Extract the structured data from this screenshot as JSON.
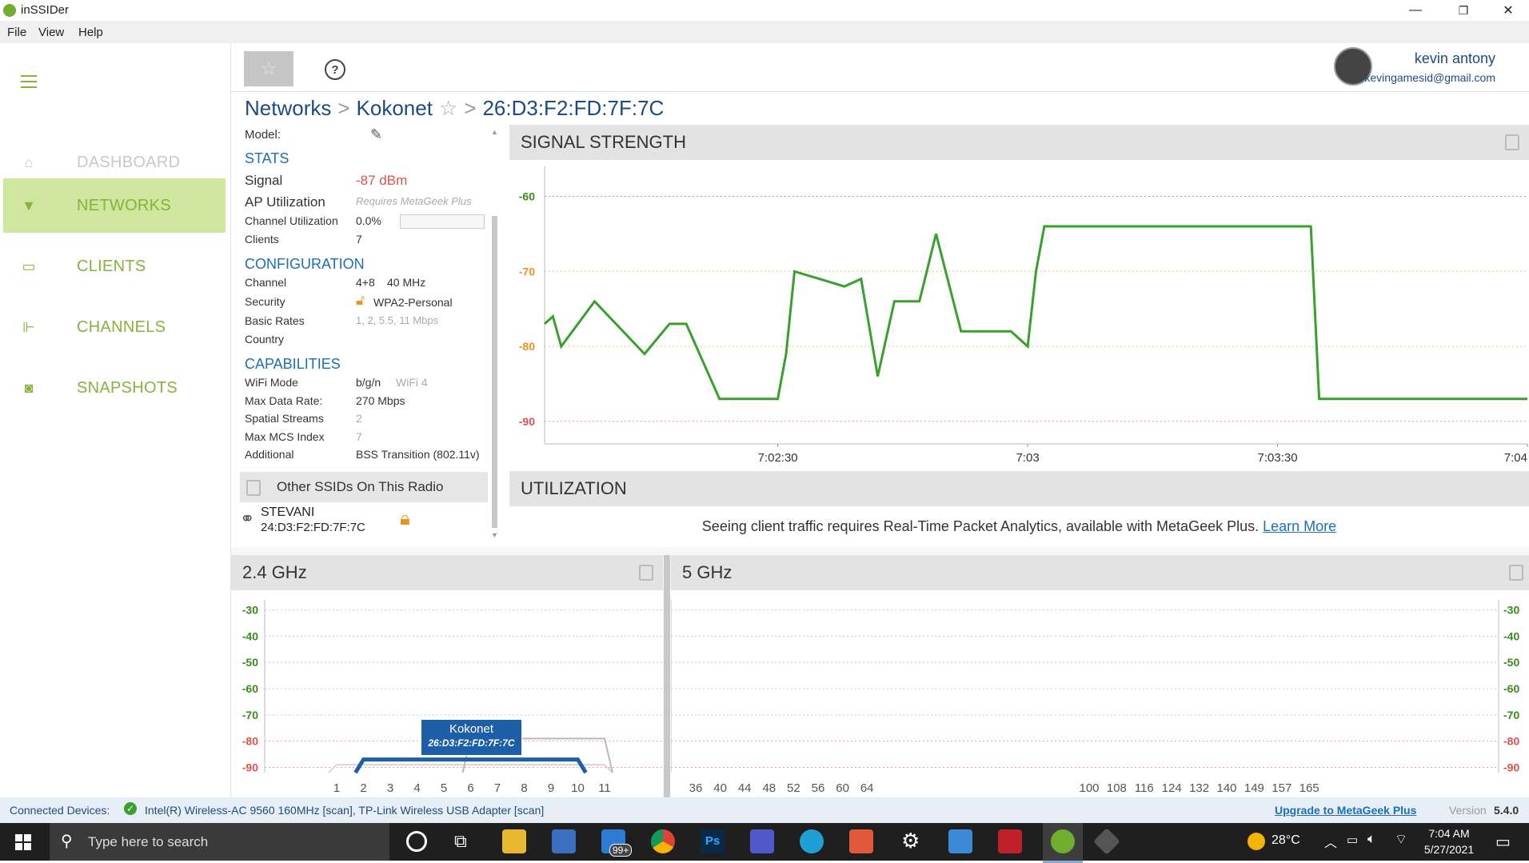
{
  "app": {
    "title": "inSSIDer"
  },
  "window_controls": {
    "minimize": "—",
    "restore": "❐",
    "close": "✕"
  },
  "menu": [
    "File",
    "View",
    "Help"
  ],
  "sidebar": {
    "items": [
      {
        "label": "DASHBOARD",
        "icon": "home-icon",
        "state": "disabled"
      },
      {
        "label": "NETWORKS",
        "icon": "wifi-icon",
        "state": "active"
      },
      {
        "label": "CLIENTS",
        "icon": "laptop-icon",
        "state": "normal"
      },
      {
        "label": "CHANNELS",
        "icon": "channels-icon",
        "state": "normal"
      },
      {
        "label": "SNAPSHOTS",
        "icon": "camera-icon",
        "state": "normal"
      }
    ]
  },
  "user": {
    "name": "kevin antony",
    "email": "kevingamesid@gmail.com"
  },
  "breadcrumb": {
    "root": "Networks",
    "network": "Kokonet",
    "bssid": "26:D3:F2:FD:7F:7C"
  },
  "details": {
    "model_label": "Model:",
    "stats": {
      "heading": "STATS",
      "signal_label": "Signal",
      "signal_value": "-87 dBm",
      "ap_util_label": "AP Utilization",
      "ap_util_value": "Requires MetaGeek Plus",
      "chan_util_label": "Channel Utilization",
      "chan_util_value": "0.0%",
      "clients_label": "Clients",
      "clients_value": "7"
    },
    "configuration": {
      "heading": "CONFIGURATION",
      "channel_label": "Channel",
      "channel_value": "4+8",
      "channel_width": "40 MHz",
      "security_label": "Security",
      "security_value": "WPA2-Personal",
      "rates_label": "Basic Rates",
      "rates_value": "1, 2, 5.5, 11 Mbps",
      "country_label": "Country",
      "country_value": ""
    },
    "capabilities": {
      "heading": "CAPABILITIES",
      "wifi_mode_label": "WiFi Mode",
      "wifi_mode_value": "b/g/n",
      "wifi_gen": "WiFi 4",
      "max_rate_label": "Max Data Rate:",
      "max_rate_value": "270 Mbps",
      "spatial_label": "Spatial Streams",
      "spatial_value": "2",
      "mcs_label": "Max MCS Index",
      "mcs_value": "7",
      "additional_label": "Additional",
      "additional_value": "BSS Transition (802.11v)"
    },
    "other_ssids": {
      "heading": "Other SSIDs On This Radio",
      "items": [
        {
          "ssid": "STEVANI",
          "bssid": "24:D3:F2:FD:7F:7C"
        }
      ]
    }
  },
  "signal_panel": {
    "title": "SIGNAL STRENGTH"
  },
  "utilization_panel": {
    "title": "UTILIZATION",
    "message": "Seeing client traffic requires Real-Time Packet Analytics, available with MetaGeek Plus.",
    "link": "Learn More"
  },
  "band24_panel": {
    "title": "2.4 GHz",
    "tooltip_ssid": "Kokonet",
    "tooltip_bssid": "26:D3:F2:FD:7F:7C"
  },
  "band5_panel": {
    "title": "5 GHz"
  },
  "chart_data": [
    {
      "type": "line",
      "name": "signal-strength",
      "x": [
        "7:02:02",
        "7:02:03",
        "7:02:04",
        "7:02:08",
        "7:02:14",
        "7:02:17",
        "7:02:19",
        "7:02:23",
        "7:02:30",
        "7:02:31",
        "7:02:32",
        "7:02:38",
        "7:02:40",
        "7:02:42",
        "7:02:44",
        "7:02:47",
        "7:02:49",
        "7:02:52",
        "7:02:58",
        "7:03:00",
        "7:03:01",
        "7:03:02",
        "7:03:34",
        "7:03:35",
        "7:04:00"
      ],
      "values": [
        -77,
        -76,
        -80,
        -74,
        -81,
        -77,
        -77,
        -87,
        -87,
        -81,
        -70,
        -72,
        -71,
        -84,
        -74,
        -74,
        -65,
        -78,
        -78,
        -80,
        -70,
        -64,
        -64,
        -87,
        -87
      ],
      "ylim": [
        -93,
        -56
      ],
      "yticks": [
        "-60",
        "-70",
        "-80",
        "-90"
      ],
      "xticks": [
        "7:02:30",
        "7:03",
        "7:03:30",
        "7:04"
      ],
      "colors": {
        "line": "#3aa02d",
        "tick_good": "#3a8a1d",
        "tick_mid": "#e6961c",
        "tick_bad": "#d9534f"
      }
    },
    {
      "type": "area",
      "name": "2.4-ghz-channels",
      "x_ticks": [
        "1",
        "2",
        "3",
        "4",
        "5",
        "6",
        "7",
        "8",
        "9",
        "10",
        "11"
      ],
      "y_ticks": [
        "-30",
        "-40",
        "-50",
        "-60",
        "-70",
        "-80",
        "-90"
      ],
      "ylim": [
        -92,
        -28
      ],
      "series": [
        {
          "channel_start": 2,
          "channel_end": 10,
          "level": -87,
          "color": "#1d5fa6",
          "highlight": true
        },
        {
          "channel_start": 6,
          "channel_end": 11,
          "level": -79,
          "color": "#b9b9b9"
        },
        {
          "channel_start": 1,
          "channel_end": 11,
          "level": -89,
          "color": "#d6d6d6"
        }
      ]
    },
    {
      "type": "area",
      "name": "5-ghz-channels",
      "x_ticks": [
        "36",
        "40",
        "44",
        "48",
        "52",
        "56",
        "60",
        "64",
        "100",
        "108",
        "116",
        "124",
        "132",
        "140",
        "149",
        "157",
        "165"
      ],
      "y_ticks": [
        "-30",
        "-40",
        "-50",
        "-60",
        "-70",
        "-80",
        "-90"
      ],
      "ylim": [
        -92,
        -28
      ],
      "series": []
    }
  ],
  "status": {
    "connected_label": "Connected Devices:",
    "devices": "Intel(R) Wireless-AC 9560 160MHz [scan], TP-Link Wireless USB Adapter [scan]",
    "upgrade": "Upgrade to MetaGeek Plus",
    "version_label": "Version",
    "version": "5.4.0"
  },
  "taskbar": {
    "search_placeholder": "Type here to search",
    "badge": "99+",
    "weather": "28°C",
    "time": "7:04 AM",
    "date": "5/27/2021"
  }
}
